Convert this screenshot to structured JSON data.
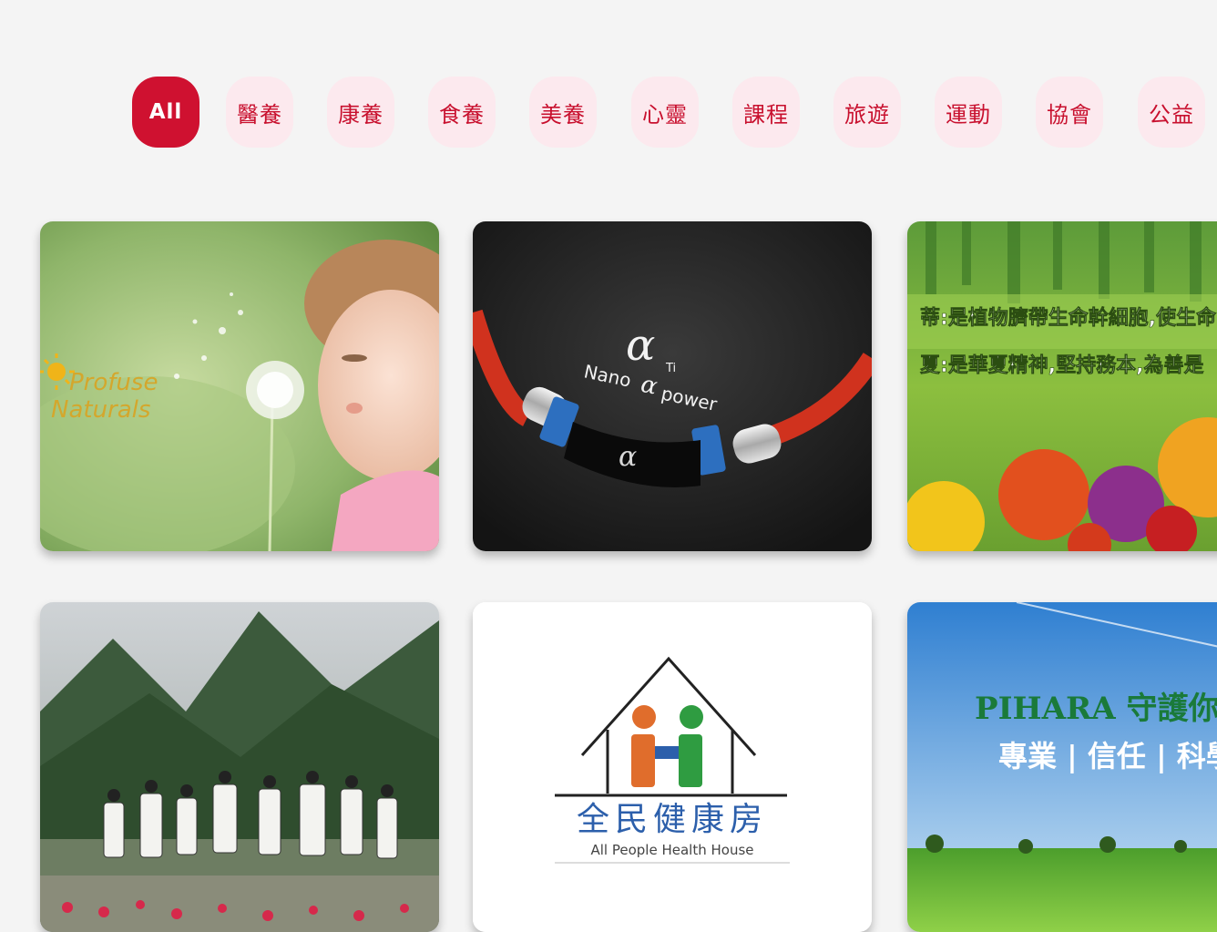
{
  "filters": [
    "All",
    "醫養",
    "康養",
    "食養",
    "美養",
    "心靈",
    "課程",
    "旅遊",
    "運動",
    "協會",
    "公益"
  ],
  "cards": {
    "card1": {
      "logo_line1": "Profuse",
      "logo_line2": "Naturals"
    },
    "card2": {
      "brand": "Nano",
      "brand2": "power"
    },
    "card3": {
      "line1": "蒂:是植物臍帶生命幹細胞,使生命",
      "line2": "夏:是華夏精神,堅持務本,為善是"
    },
    "card4": {},
    "card5": {
      "title": "全民健康房",
      "subtitle": "All People Health House"
    },
    "card6": {
      "headline": "PIHARA 守護你的健康",
      "tagline": "專業 | 信任 | 科學"
    }
  }
}
